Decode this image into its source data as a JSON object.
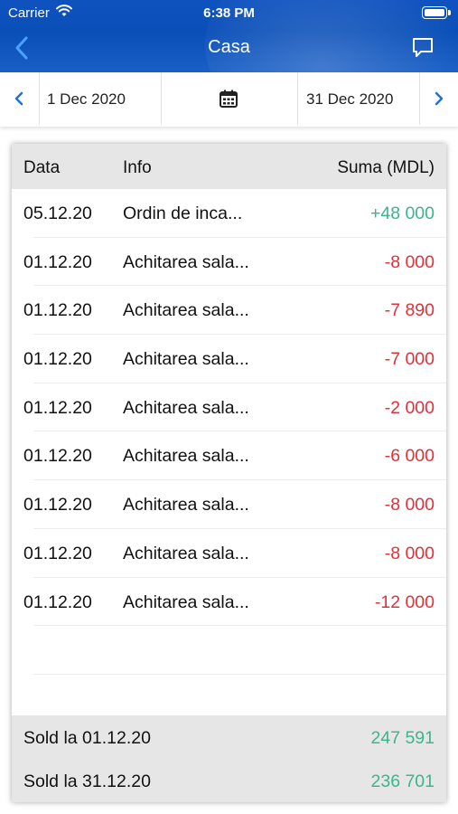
{
  "status_bar": {
    "carrier": "Carrier",
    "time": "6:38 PM"
  },
  "nav": {
    "title": "Casa",
    "back_icon": "chevron-left-icon",
    "action_icon": "chat-bubble-icon"
  },
  "date_range": {
    "from": "1 Dec 2020",
    "to": "31 Dec 2020",
    "calendar_icon": "calendar-icon"
  },
  "table": {
    "headers": {
      "date": "Data",
      "info": "Info",
      "sum": "Suma (MDL)"
    },
    "rows": [
      {
        "date": "05.12.20",
        "info": "Ordin de inca...",
        "sum": "+48 000",
        "sign": "pos"
      },
      {
        "date": "01.12.20",
        "info": "Achitarea sala...",
        "sum": "-8 000",
        "sign": "neg"
      },
      {
        "date": "01.12.20",
        "info": "Achitarea sala...",
        "sum": "-7 890",
        "sign": "neg"
      },
      {
        "date": "01.12.20",
        "info": "Achitarea sala...",
        "sum": "-7 000",
        "sign": "neg"
      },
      {
        "date": "01.12.20",
        "info": "Achitarea sala...",
        "sum": "-2 000",
        "sign": "neg"
      },
      {
        "date": "01.12.20",
        "info": "Achitarea sala...",
        "sum": "-6 000",
        "sign": "neg"
      },
      {
        "date": "01.12.20",
        "info": "Achitarea sala...",
        "sum": "-8 000",
        "sign": "neg"
      },
      {
        "date": "01.12.20",
        "info": "Achitarea sala...",
        "sum": "-8 000",
        "sign": "neg"
      },
      {
        "date": "01.12.20",
        "info": "Achitarea sala...",
        "sum": "-12 000",
        "sign": "neg"
      }
    ],
    "footer": [
      {
        "label": "Sold la 01.12.20",
        "value": "247 591"
      },
      {
        "label": "Sold la 31.12.20",
        "value": "236 701"
      }
    ]
  },
  "colors": {
    "header_blue": "#0f52bf",
    "positive": "#3db58a",
    "negative": "#e0323a",
    "accent": "#1a73d9"
  }
}
